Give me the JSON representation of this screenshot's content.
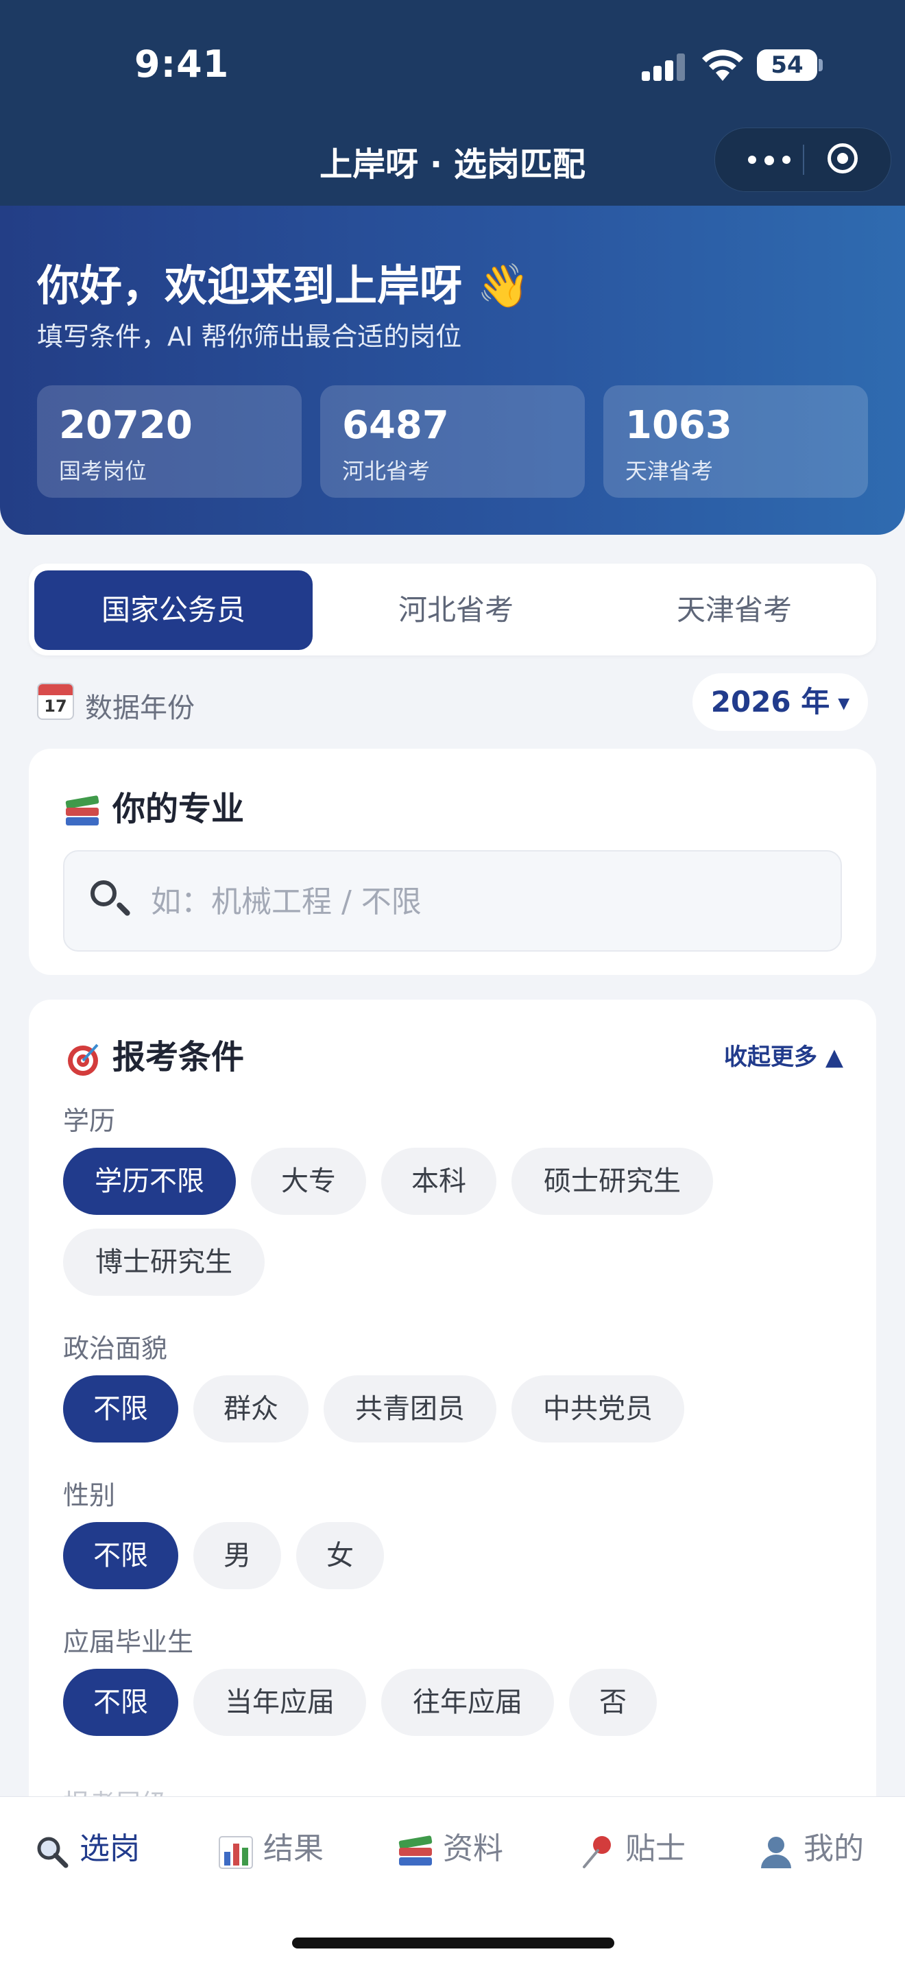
{
  "status": {
    "time": "9:41",
    "battery": "54"
  },
  "nav": {
    "title": "上岸呀 · 选岗匹配"
  },
  "hero": {
    "title": "你好，欢迎来到上岸呀 👋",
    "subtitle": "填写条件，AI 帮你筛出最合适的岗位",
    "stats": [
      {
        "value": "20720",
        "label": "国考岗位"
      },
      {
        "value": "6487",
        "label": "河北省考"
      },
      {
        "value": "1063",
        "label": "天津省考"
      }
    ]
  },
  "segments": [
    "国家公务员",
    "河北省考",
    "天津省考"
  ],
  "year": {
    "label": "数据年份",
    "calendar_day": "17",
    "value": "2026 年"
  },
  "major": {
    "title": "你的专业",
    "placeholder": "如：机械工程 / 不限",
    "value": ""
  },
  "conditions": {
    "title": "报考条件",
    "collapse_label": "收起更多 ▲",
    "education": {
      "label": "学历",
      "options": [
        "学历不限",
        "大专",
        "本科",
        "硕士研究生",
        "博士研究生"
      ],
      "selected": "学历不限"
    },
    "political": {
      "label": "政治面貌",
      "options": [
        "不限",
        "群众",
        "共青团员",
        "中共党员"
      ],
      "selected": "不限"
    },
    "gender": {
      "label": "性别",
      "options": [
        "不限",
        "男",
        "女"
      ],
      "selected": "不限"
    },
    "fresh_grad": {
      "label": "应届毕业生",
      "options": [
        "不限",
        "当年应届",
        "往年应届",
        "否"
      ],
      "selected": "不限"
    },
    "next_label_partial": "报考层级"
  },
  "tabbar": [
    {
      "icon": "search-icon",
      "label": "选岗",
      "active": true
    },
    {
      "icon": "chart-icon",
      "label": "结果",
      "active": false
    },
    {
      "icon": "books-icon",
      "label": "资料",
      "active": false
    },
    {
      "icon": "pin-icon",
      "label": "贴士",
      "active": false
    },
    {
      "icon": "user-icon",
      "label": "我的",
      "active": false
    }
  ],
  "colors": {
    "primary": "#213b8c",
    "header": "#1d3a63",
    "background": "#f2f4f8"
  }
}
